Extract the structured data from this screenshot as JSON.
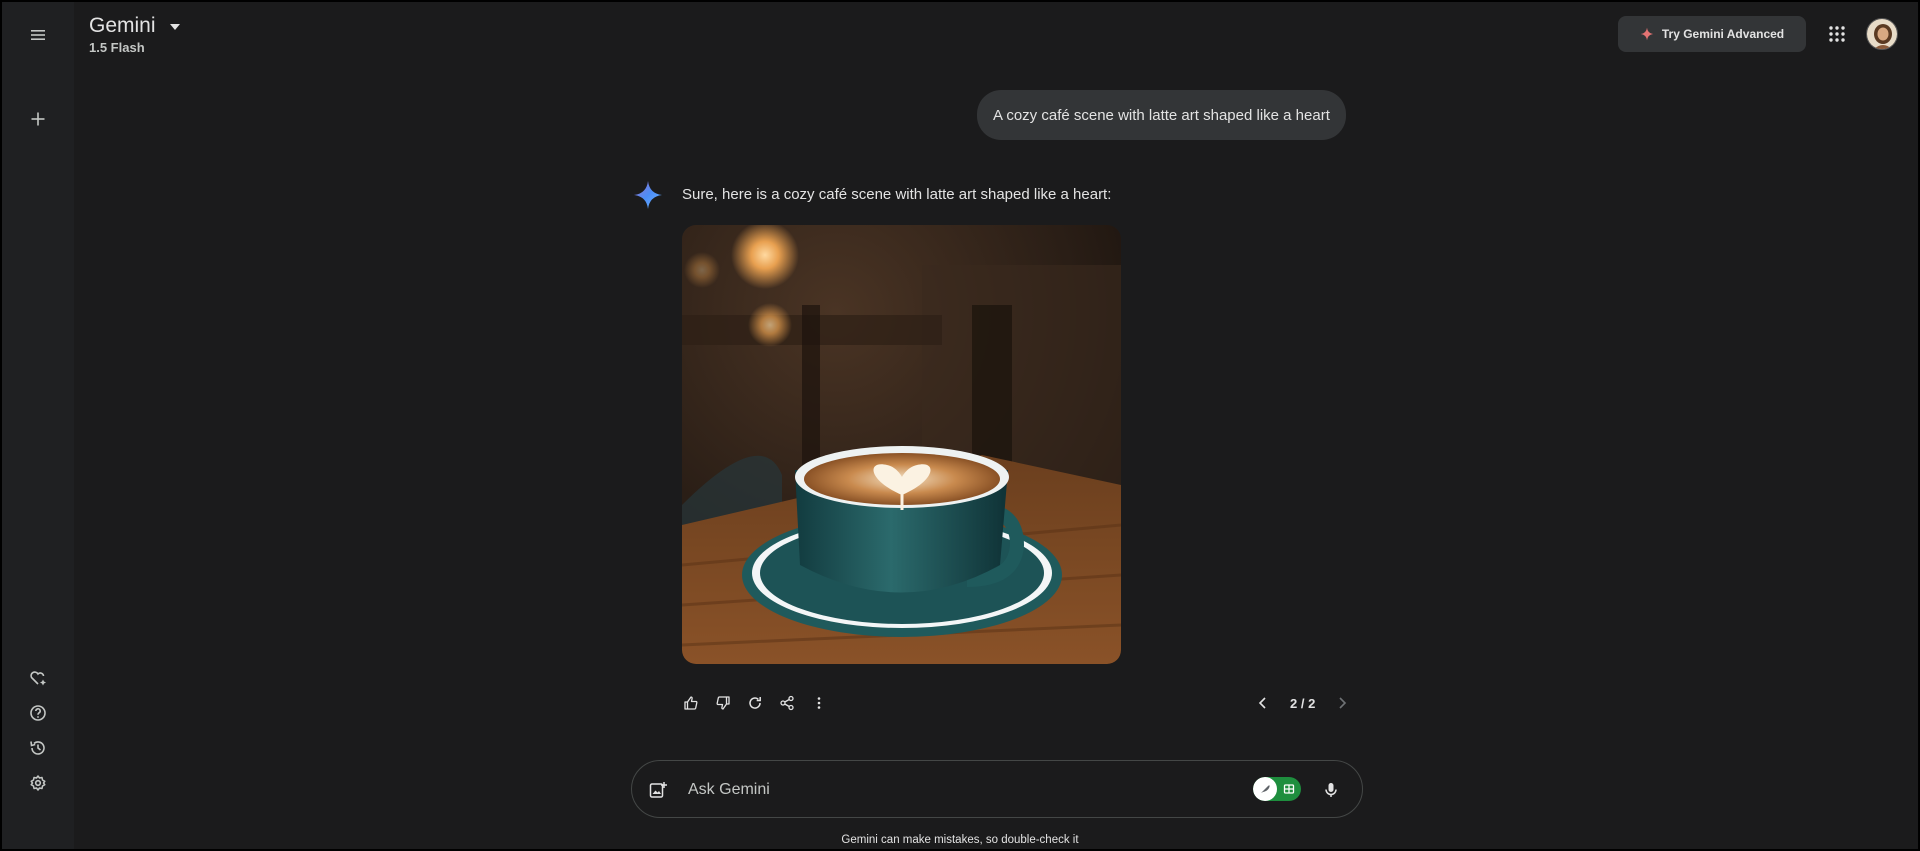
{
  "header": {
    "title": "Gemini",
    "model": "1.5 Flash",
    "advanced_label": "Try Gemini Advanced"
  },
  "rail": {
    "top_icons": [
      "menu-icon",
      "new-chat-icon"
    ],
    "bottom_icons": [
      "gem-manager-icon",
      "help-icon",
      "activity-icon",
      "settings-icon"
    ]
  },
  "conversation": {
    "user_prompt": "A cozy café scene with latte art shaped like a heart",
    "response_text": "Sure, here is a cozy café scene with latte art shaped like a heart:",
    "image_subject": "latte with heart latte art in a teal cup on a wooden café table",
    "pager": "2 / 2"
  },
  "input": {
    "placeholder": "Ask Gemini"
  },
  "footer": {
    "disclaimer": "Gemini can make mistakes, so double-check it"
  },
  "colors": {
    "background": "#1b1b1c",
    "rail": "#1f2022",
    "bubble": "#333537",
    "accent_spark": "#4c8df6",
    "advanced_spark": "#e57373",
    "toggle_green": "#1e8e3e"
  }
}
